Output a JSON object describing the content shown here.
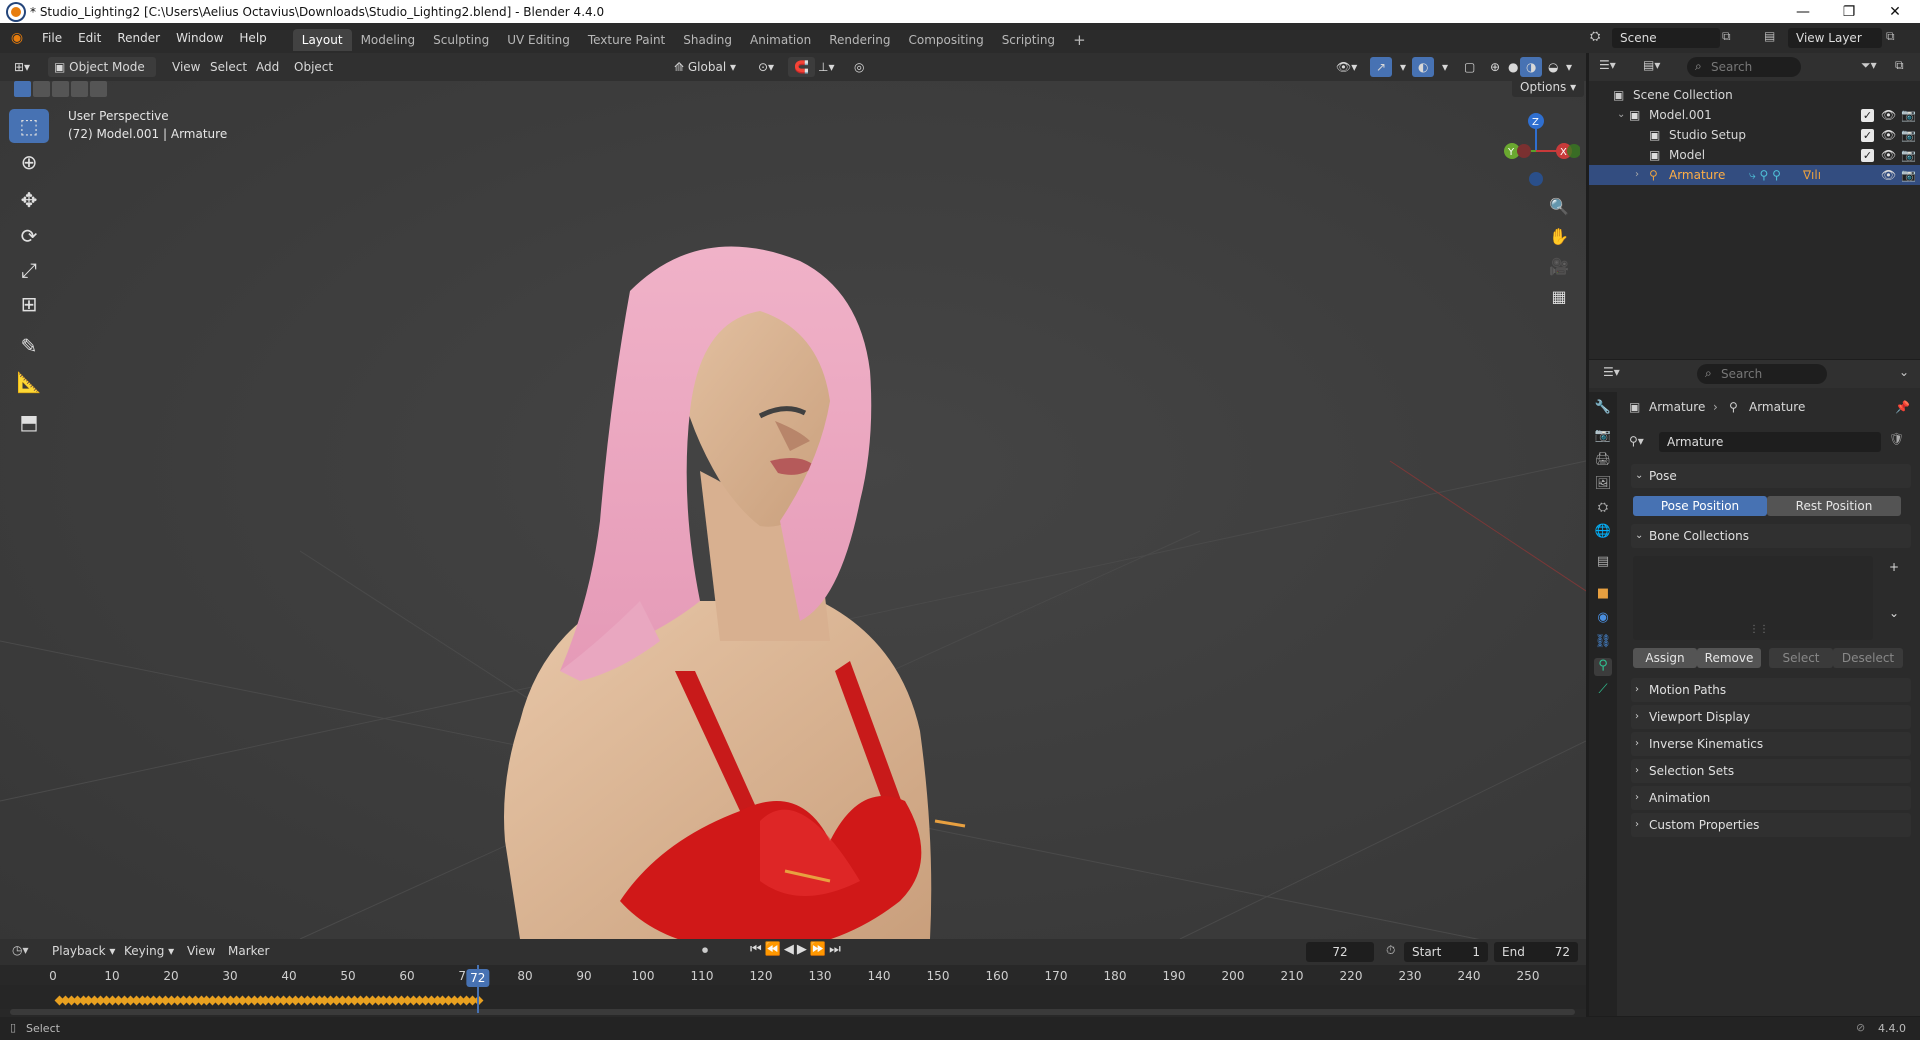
{
  "window": {
    "title": "* Studio_Lighting2 [C:\\Users\\Aelius Octavius\\Downloads\\Studio_Lighting2.blend] - Blender 4.4.0",
    "controls": {
      "minimize": "—",
      "restore": "❐",
      "close": "✕"
    }
  },
  "menu": [
    "File",
    "Edit",
    "Render",
    "Window",
    "Help"
  ],
  "workspaces": [
    "Layout",
    "Modeling",
    "Sculpting",
    "UV Editing",
    "Texture Paint",
    "Shading",
    "Animation",
    "Rendering",
    "Compositing",
    "Scripting"
  ],
  "add_workspace": "+",
  "scene": {
    "label": "Scene",
    "view_layer": "View Layer"
  },
  "viewport_header": {
    "mode": "Object Mode",
    "menus": [
      "View",
      "Select",
      "Add",
      "Object"
    ],
    "orientation": "Global",
    "options": "Options"
  },
  "viewport": {
    "overlay_title": "User Perspective",
    "overlay_subtitle": "(72) Model.001 | Armature",
    "gizmo": {
      "z": "Z",
      "y": "Y",
      "x": "X"
    }
  },
  "outliner": {
    "search_placeholder": "Search",
    "rows": [
      {
        "label": "Scene Collection"
      },
      {
        "label": "Model.001"
      },
      {
        "label": "Studio Setup"
      },
      {
        "label": "Model"
      },
      {
        "label": "Armature"
      }
    ]
  },
  "properties": {
    "search_placeholder": "Search",
    "breadcrumb": [
      "Armature",
      "Armature"
    ],
    "data_name": "Armature",
    "pose_panel": "Pose",
    "pose_position": "Pose Position",
    "rest_position": "Rest Position",
    "bone_collections": "Bone Collections",
    "assign": "Assign",
    "remove": "Remove",
    "select": "Select",
    "deselect": "Deselect",
    "collapsed_panels": [
      "Motion Paths",
      "Viewport Display",
      "Inverse Kinematics",
      "Selection Sets",
      "Animation",
      "Custom Properties"
    ]
  },
  "timeline": {
    "menus": [
      "Playback",
      "Keying",
      "View",
      "Marker"
    ],
    "current_frame": "72",
    "start_label": "Start",
    "start_value": "1",
    "end_label": "End",
    "end_value": "72",
    "ticks": [
      "0",
      "10",
      "20",
      "30",
      "40",
      "50",
      "60",
      "70",
      "80",
      "90",
      "100",
      "110",
      "120",
      "130",
      "140",
      "150",
      "160",
      "170",
      "180",
      "190",
      "200",
      "210",
      "220",
      "230",
      "240",
      "250"
    ],
    "playhead": "72"
  },
  "status": {
    "left": "Select",
    "version": "4.4.0"
  },
  "colors": {
    "accent": "#4772b3",
    "selected_row": "#334d80",
    "keyframe": "#e8a020",
    "playhead": "#4772b3"
  }
}
